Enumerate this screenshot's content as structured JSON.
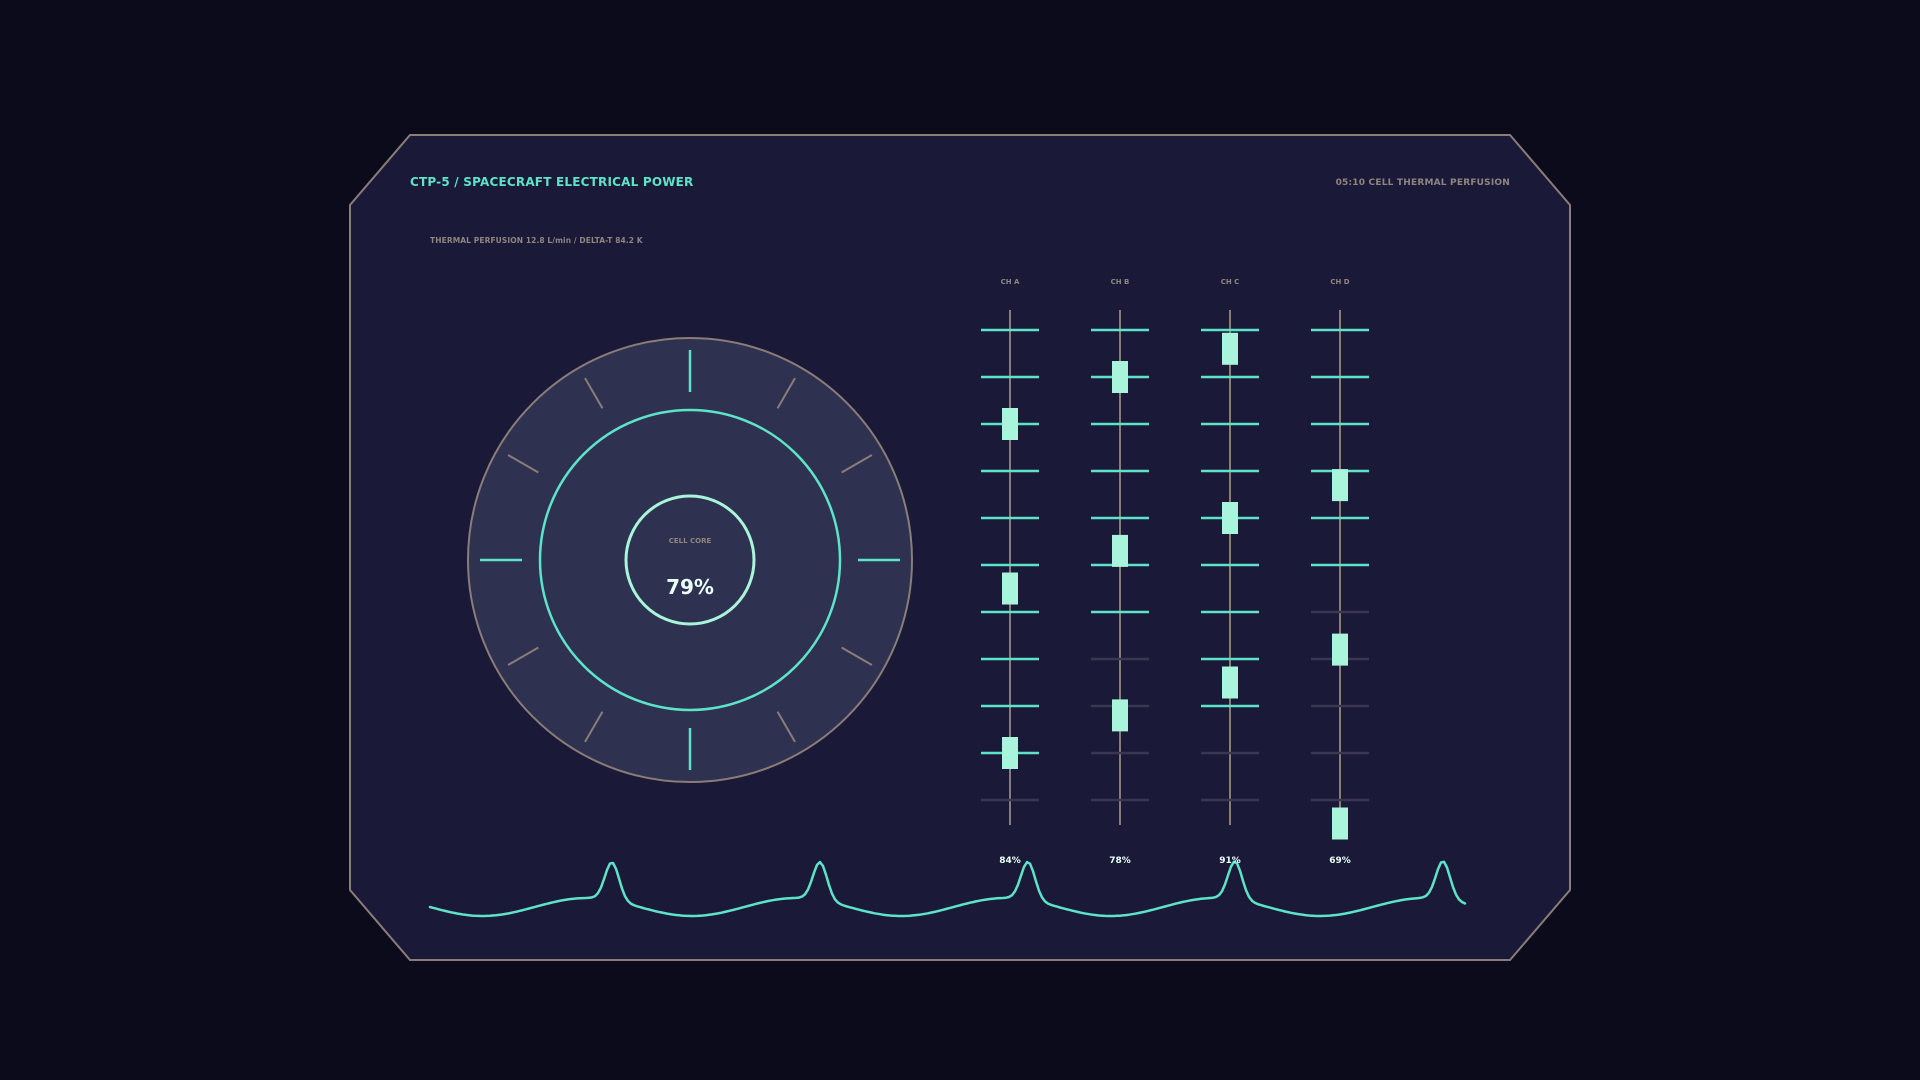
{
  "header": {
    "title": "CTP-5  /  SPACECRAFT ELECTRICAL POWER",
    "clock": "05:10  CELL THERMAL PERFUSION"
  },
  "readout": {
    "text": "THERMAL PERFUSION  12.8 L/min  /  DELTA-T 84.2 K"
  },
  "core": {
    "label": "CELL CORE",
    "value": "79%",
    "level": 0.79
  },
  "channels": [
    {
      "name": "CH A",
      "value": "84%",
      "active_rungs": 10,
      "markers": [
        2,
        5.5,
        9
      ]
    },
    {
      "name": "CH B",
      "value": "78%",
      "active_rungs": 7,
      "markers": [
        1,
        4.7,
        8.2
      ]
    },
    {
      "name": "CH C",
      "value": "91%",
      "active_rungs": 9,
      "markers": [
        0.4,
        4,
        7.5
      ]
    },
    {
      "name": "CH D",
      "value": "69%",
      "active_rungs": 6,
      "markers": [
        3.3,
        6.8,
        10.5
      ]
    }
  ],
  "colors": {
    "background": "#0c0b1b",
    "panel": "#1b1938",
    "panel_border": "#8a7d78",
    "accent": "#5de3c8",
    "marker": "#a8f5dc",
    "tick_muted": "#8a7d78",
    "dim_rung": "#3a3850",
    "text_muted": "#8f8580",
    "text_bright": "#e8fff7",
    "dial_fill": "#2e3150"
  },
  "icons": {
    "dial": "radial-gauge",
    "waveform": "pulse-waveform"
  }
}
